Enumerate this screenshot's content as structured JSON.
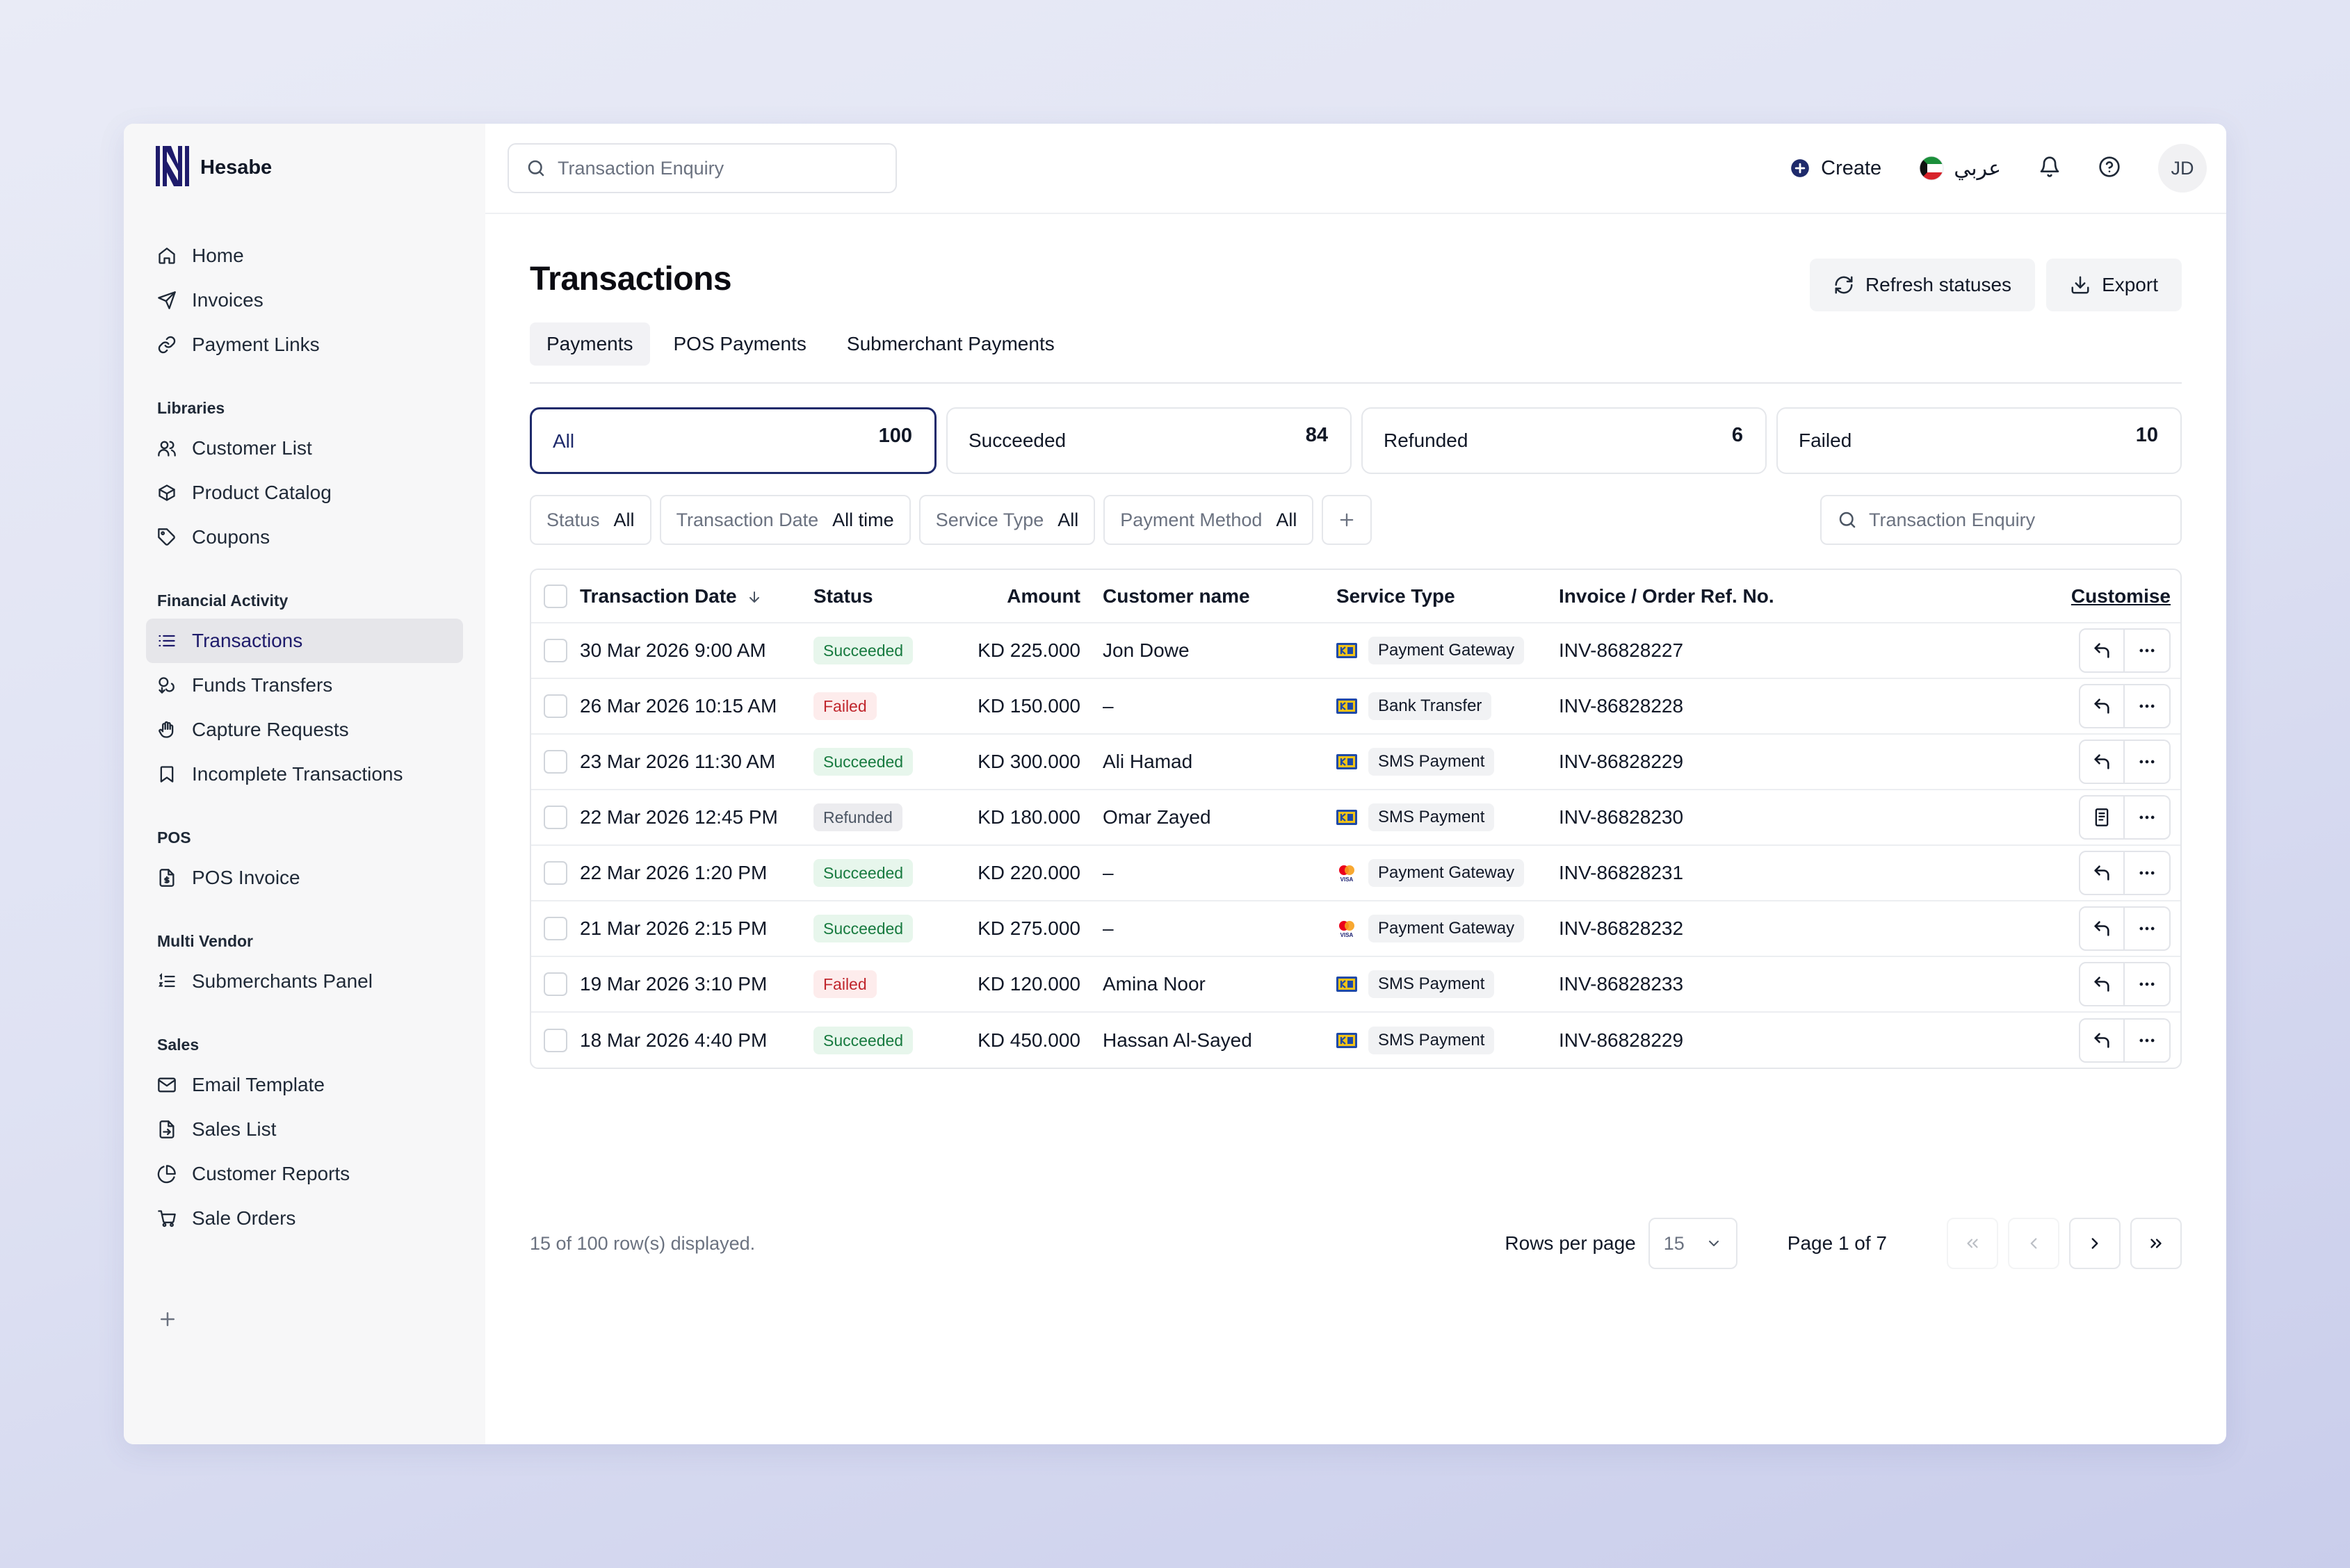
{
  "brand": {
    "name": "Hesabe"
  },
  "sidebar": {
    "main_items": [
      {
        "label": "Home",
        "icon": "home-icon"
      },
      {
        "label": "Invoices",
        "icon": "send-icon"
      },
      {
        "label": "Payment Links",
        "icon": "link-icon"
      }
    ],
    "sections": [
      {
        "title": "Libraries",
        "items": [
          {
            "label": "Customer List",
            "icon": "users-icon"
          },
          {
            "label": "Product Catalog",
            "icon": "box-icon"
          },
          {
            "label": "Coupons",
            "icon": "tag-icon"
          }
        ]
      },
      {
        "title": "Financial Activity",
        "items": [
          {
            "label": "Transactions",
            "icon": "list-icon",
            "active": true
          },
          {
            "label": "Funds Transfers",
            "icon": "coins-icon"
          },
          {
            "label": "Capture Requests",
            "icon": "hand-icon"
          },
          {
            "label": "Incomplete Transactions",
            "icon": "bookmark-icon"
          }
        ]
      },
      {
        "title": "POS",
        "items": [
          {
            "label": "POS Invoice",
            "icon": "file-dollar-icon"
          }
        ]
      },
      {
        "title": "Multi Vendor",
        "items": [
          {
            "label": "Submerchants Panel",
            "icon": "list-ordered-icon"
          }
        ]
      },
      {
        "title": "Sales",
        "items": [
          {
            "label": "Email Template",
            "icon": "mail-icon"
          },
          {
            "label": "Sales List",
            "icon": "file-export-icon"
          },
          {
            "label": "Customer Reports",
            "icon": "pie-chart-icon"
          },
          {
            "label": "Sale Orders",
            "icon": "cart-icon"
          }
        ]
      }
    ]
  },
  "topbar": {
    "search_placeholder": "Transaction Enquiry",
    "create_label": "Create",
    "language_label": "عربي",
    "avatar_initials": "JD"
  },
  "page": {
    "title": "Transactions",
    "refresh_label": "Refresh statuses",
    "export_label": "Export",
    "tabs": [
      "Payments",
      "POS Payments",
      "Submerchant Payments"
    ],
    "active_tab": "Payments"
  },
  "stats": [
    {
      "label": "All",
      "count": "100"
    },
    {
      "label": "Succeeded",
      "count": "84"
    },
    {
      "label": "Refunded",
      "count": "6"
    },
    {
      "label": "Failed",
      "count": "10"
    }
  ],
  "filters": [
    {
      "key": "Status",
      "value": "All"
    },
    {
      "key": "Transaction Date",
      "value": "All time"
    },
    {
      "key": "Service Type",
      "value": "All"
    },
    {
      "key": "Payment Method",
      "value": "All"
    }
  ],
  "filter_search_placeholder": "Transaction Enquiry",
  "table": {
    "headers": {
      "date": "Transaction Date",
      "status": "Status",
      "amount": "Amount",
      "customer": "Customer name",
      "service": "Service Type",
      "invoice": "Invoice / Order Ref. No.",
      "customise": "Customise"
    },
    "rows": [
      {
        "date": "30 Mar 2026 9:00 AM",
        "status": "Succeeded",
        "amount": "KD 225.000",
        "customer": "Jon Dowe",
        "service": "Payment Gateway",
        "logo": "knet",
        "invoice": "INV-86828227",
        "action": "refund"
      },
      {
        "date": "26 Mar 2026 10:15 AM",
        "status": "Failed",
        "amount": "KD 150.000",
        "customer": "–",
        "service": "Bank Transfer",
        "logo": "knet",
        "invoice": "INV-86828228",
        "action": "refund"
      },
      {
        "date": "23 Mar 2026 11:30 AM",
        "status": "Succeeded",
        "amount": "KD 300.000",
        "customer": "Ali Hamad",
        "service": "SMS Payment",
        "logo": "knet",
        "invoice": "INV-86828229",
        "action": "refund"
      },
      {
        "date": "22 Mar 2026 12:45 PM",
        "status": "Refunded",
        "amount": "KD 180.000",
        "customer": "Omar Zayed",
        "service": "SMS Payment",
        "logo": "knet",
        "invoice": "INV-86828230",
        "action": "receipt"
      },
      {
        "date": "22 Mar 2026 1:20 PM",
        "status": "Succeeded",
        "amount": "KD 220.000",
        "customer": "–",
        "service": "Payment Gateway",
        "logo": "mastercard-visa",
        "invoice": "INV-86828231",
        "action": "refund"
      },
      {
        "date": "21 Mar 2026 2:15 PM",
        "status": "Succeeded",
        "amount": "KD 275.000",
        "customer": "–",
        "service": "Payment Gateway",
        "logo": "mastercard-visa",
        "invoice": "INV-86828232",
        "action": "refund"
      },
      {
        "date": "19 Mar 2026 3:10 PM",
        "status": "Failed",
        "amount": "KD 120.000",
        "customer": "Amina Noor",
        "service": "SMS Payment",
        "logo": "knet",
        "invoice": "INV-86828233",
        "action": "refund"
      },
      {
        "date": "18 Mar 2026 4:40 PM",
        "status": "Succeeded",
        "amount": "KD 450.000",
        "customer": "Hassan Al-Sayed",
        "service": "SMS Payment",
        "logo": "knet",
        "invoice": "INV-86828229",
        "action": "refund"
      }
    ]
  },
  "footer": {
    "rows_info": "15 of 100 row(s) displayed.",
    "rows_per_page_label": "Rows per page",
    "rows_per_page_value": "15",
    "page_info": "Page 1 of 7"
  },
  "colors": {
    "accent": "#1e2a6b",
    "succeeded": "#177a3f",
    "failed": "#c0262d",
    "refunded": "#4b5563"
  }
}
